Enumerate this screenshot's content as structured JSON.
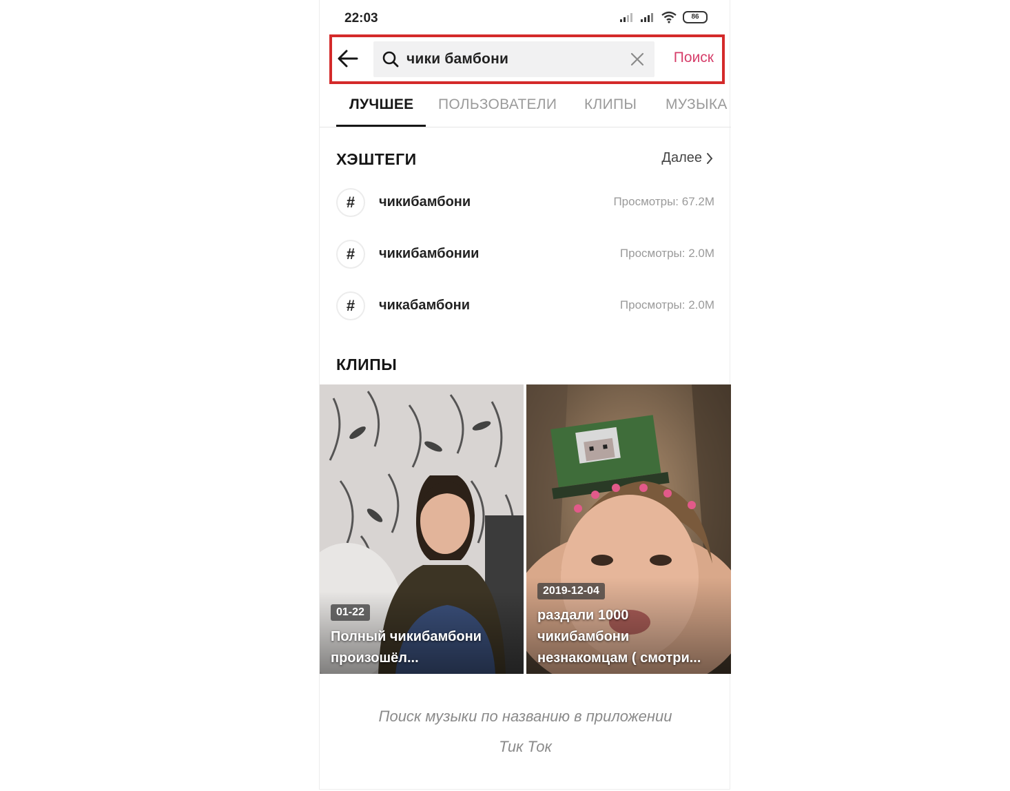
{
  "status_bar": {
    "time": "22:03",
    "battery": "86"
  },
  "search": {
    "query": "чики бамбони",
    "button_label": "Поиск"
  },
  "tabs": [
    {
      "label": "ЛУЧШЕЕ",
      "active": true
    },
    {
      "label": "ПОЛЬЗОВАТЕЛИ",
      "active": false
    },
    {
      "label": "КЛИПЫ",
      "active": false
    },
    {
      "label": "МУЗЫКА",
      "active": false
    }
  ],
  "hashtags": {
    "title": "ХЭШТЕГИ",
    "more_label": "Далее",
    "items": [
      {
        "name": "чикибамбони",
        "views": "Просмотры: 67.2M"
      },
      {
        "name": "чикибамбонии",
        "views": "Просмотры: 2.0M"
      },
      {
        "name": "чикабамбони",
        "views": "Просмотры: 2.0M"
      }
    ]
  },
  "clips": {
    "title": "КЛИПЫ",
    "items": [
      {
        "date": "01-22",
        "caption_line1": "Полный чикибамбони",
        "caption_line2": "произошёл..."
      },
      {
        "date": "2019-12-04",
        "caption_line1": "раздали 1000",
        "caption_line2": "чикибамбони",
        "caption_line3": "незнакомцам ( смотри..."
      }
    ]
  },
  "figure_caption": {
    "line1": "Поиск музыки по названию в приложении",
    "line2": "Тик Ток"
  },
  "colors": {
    "accent": "#d63e6a",
    "highlight_border": "#d42a2a"
  }
}
